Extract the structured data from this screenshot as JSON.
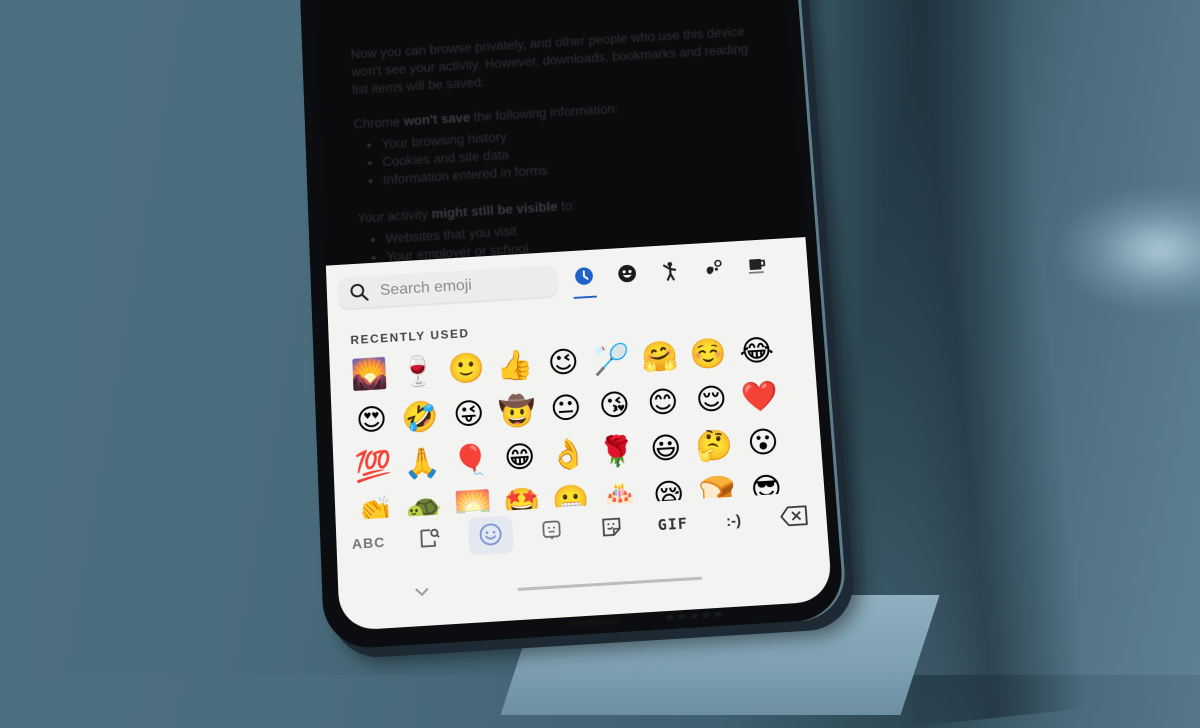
{
  "page": {
    "paragraph_1": "Now you can browse privately, and other people who use this device won't see your activity. However, downloads, bookmarks and reading list items will be saved.",
    "wont_save_prefix": "Chrome ",
    "wont_save_bold": "won't save",
    "wont_save_suffix": " the following information:",
    "wont_save_items": [
      "Your browsing history",
      "Cookies and site data",
      "Information entered in forms"
    ],
    "visible_prefix": "Your activity ",
    "visible_bold": "might still be visible",
    "visible_suffix": " to:",
    "visible_items": [
      "Websites that you visit",
      "Your employer or school"
    ]
  },
  "keyboard": {
    "search": {
      "placeholder": "Search emoji",
      "icon": "search-icon"
    },
    "category_tabs": [
      {
        "name": "recent",
        "icon": "clock-icon",
        "active": true
      },
      {
        "name": "smileys",
        "icon": "smiley-icon",
        "active": false
      },
      {
        "name": "people",
        "icon": "person-icon",
        "active": false
      },
      {
        "name": "animals-nature",
        "icon": "nature-icon",
        "active": false
      },
      {
        "name": "food-drink",
        "icon": "cup-icon",
        "active": false
      }
    ],
    "section_label": "RECENTLY USED",
    "recent_emojis": [
      "🌄",
      "🍷",
      "🙂",
      "👍",
      "😉",
      "🏸",
      "🤗",
      "☺️",
      "😂",
      "😍",
      "🤣",
      "😜",
      "🤠",
      "😐",
      "😘",
      "😊",
      "😌",
      "❤️",
      "💯",
      "🙏",
      "🎈",
      "😁",
      "👌",
      "🌹",
      "😃",
      "🤔",
      "😮",
      "👏",
      "🐢",
      "🌅",
      "🤩",
      "😬",
      "🎂",
      "😪",
      "🍞",
      "😎"
    ],
    "bottom_bar": {
      "abc_label": "ABC",
      "emoji_search_icon": "sticker-search-icon",
      "emoji_tab_icon": "smiley-face-icon",
      "bitmoji_icon": "bitmoji-icon",
      "sticker_icon": "sticker-icon",
      "gif_label": "GIF",
      "emoticon_label": ":-)",
      "backspace_icon": "backspace-icon"
    },
    "collapse_icon": "chevron-down-icon"
  },
  "colors": {
    "accent": "#1f62c8",
    "keyboard_bg": "#f3f3f1",
    "screen_bg": "#0a0b0d",
    "background": "#4d7080"
  }
}
